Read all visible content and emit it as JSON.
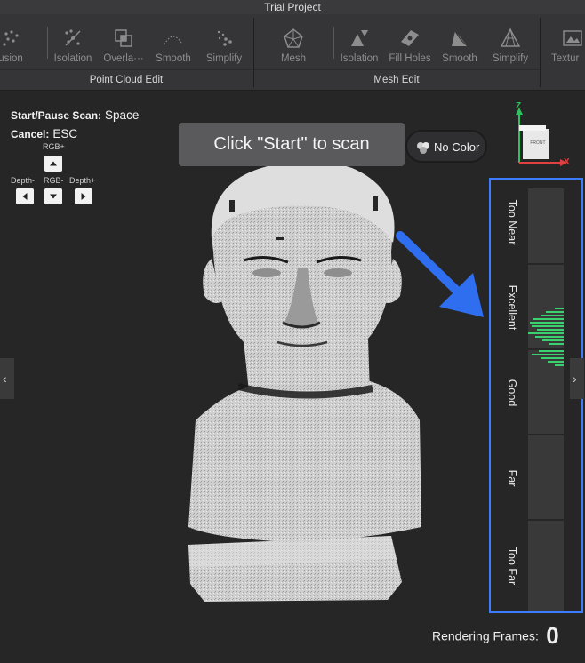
{
  "window": {
    "title": "Trial Project"
  },
  "toolbar": {
    "point_cloud_group": {
      "label": "Point Cloud Edit",
      "tools": [
        {
          "label": "usion",
          "icon": "fusion-icon"
        },
        {
          "label": "Isolation",
          "icon": "isolation-icon"
        },
        {
          "label": "Overla···",
          "icon": "overlap-icon"
        },
        {
          "label": "Smooth",
          "icon": "smooth-icon"
        },
        {
          "label": "Simplify",
          "icon": "simplify-icon"
        }
      ]
    },
    "mesh_group": {
      "label": "Mesh Edit",
      "tools": [
        {
          "label": "Mesh",
          "icon": "mesh-icon"
        },
        {
          "label": "Isolation",
          "icon": "mesh-isolation-icon"
        },
        {
          "label": "Fill Holes",
          "icon": "fill-holes-icon"
        },
        {
          "label": "Smooth",
          "icon": "mesh-smooth-icon"
        },
        {
          "label": "Simplify",
          "icon": "mesh-simplify-icon"
        }
      ]
    },
    "texture_group": {
      "tools": [
        {
          "label": "Textur",
          "icon": "texture-icon"
        }
      ]
    }
  },
  "shortcuts": {
    "scan_label": "Start/Pause Scan:",
    "scan_key": "Space",
    "cancel_label": "Cancel:",
    "cancel_key": "ESC"
  },
  "keypad": {
    "rgb_plus": "RGB+",
    "depth_minus": "Depth-",
    "rgb_minus": "RGB-",
    "depth_plus": "Depth+"
  },
  "toast": {
    "message": "Click \"Start\" to scan"
  },
  "color_toggle": {
    "label": "No Color"
  },
  "axes": {
    "z": "Z",
    "x": "X",
    "cube_face": "FRONT"
  },
  "depth_gauge": {
    "zones": [
      "Too Near",
      "Excellent",
      "Good",
      "Far",
      "Too Far"
    ],
    "current_zone": "Excellent",
    "accent_color": "#3d7bff",
    "histogram_color": "#3bd16f"
  },
  "status": {
    "frames_label": "Rendering Frames:",
    "frames_value": "0"
  }
}
